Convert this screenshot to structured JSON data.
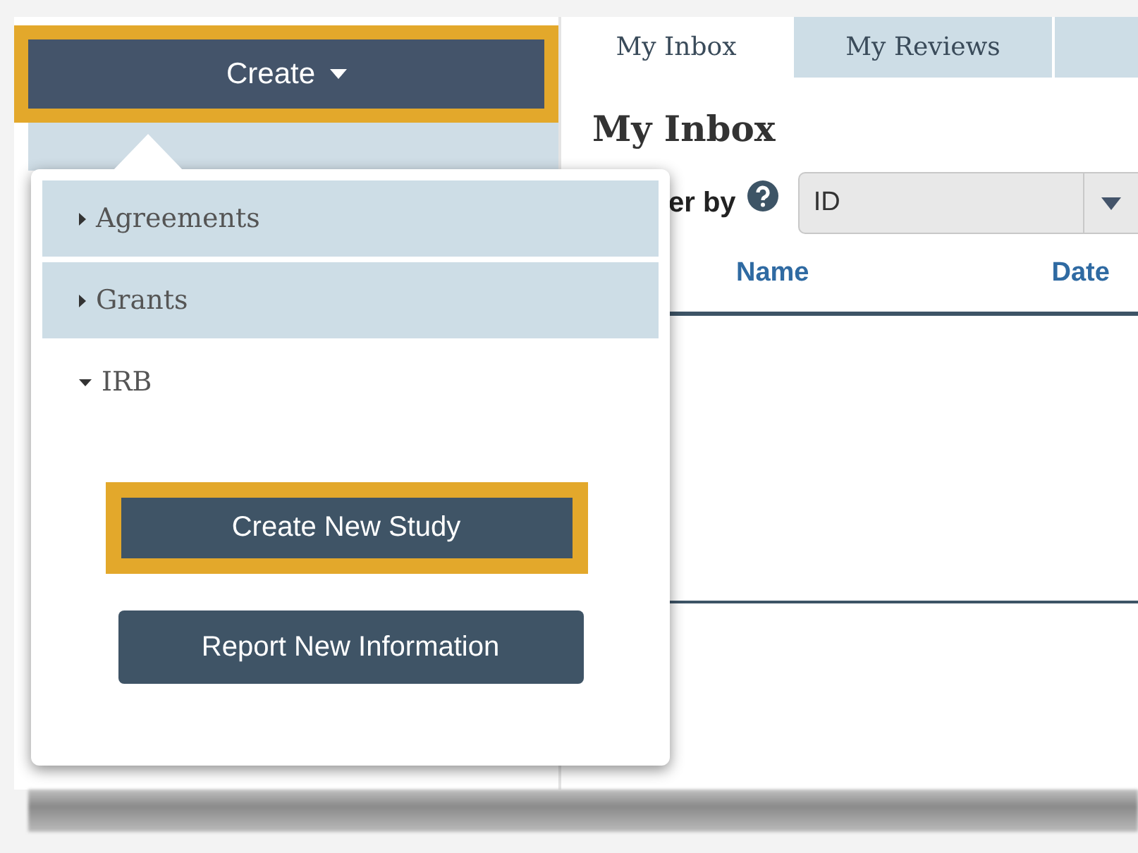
{
  "sidebar": {
    "create_button": {
      "label": "Create",
      "highlighted": true
    }
  },
  "tabs": [
    {
      "label": "My Inbox",
      "selected": true
    },
    {
      "label": "My Reviews",
      "selected": false
    },
    {
      "selected": false
    }
  ],
  "heading": "My Inbox",
  "filter": {
    "label": "er by",
    "value": "ID"
  },
  "table": {
    "columns": [
      "Name",
      "Date"
    ]
  },
  "menu": {
    "categories": [
      {
        "label": "Agreements",
        "expanded": false
      },
      {
        "label": "Grants",
        "expanded": false
      },
      {
        "label": "IRB",
        "expanded": true,
        "actions": [
          {
            "label": "Create New Study",
            "highlighted": true
          },
          {
            "label": "Report New Information",
            "highlighted": false
          }
        ]
      }
    ]
  }
}
